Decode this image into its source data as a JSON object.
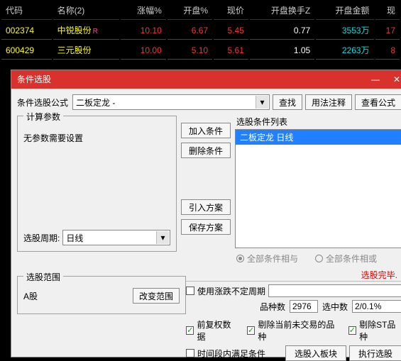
{
  "table": {
    "headers": [
      "代码",
      "名称(2)",
      "涨幅%",
      "开盘%",
      "现价",
      "开盘换手Z",
      "开盘金额",
      "现"
    ],
    "rows": [
      {
        "code": "002374",
        "name": "中锐股份",
        "flag": "R",
        "chg": "10.10",
        "openpct": "6.67",
        "price": "5.45",
        "turnover": "0.77",
        "amount": "3553万",
        "extra": "17"
      },
      {
        "code": "600429",
        "name": "三元股份",
        "flag": "",
        "chg": "10.00",
        "openpct": "5.10",
        "price": "5.61",
        "turnover": "1.05",
        "amount": "2263万",
        "extra": "8"
      }
    ]
  },
  "dialog": {
    "title": "条件选股",
    "formula_label": "条件选股公式",
    "formula_value": "二板定龙   -",
    "btn_search": "查找",
    "btn_usage": "用法注释",
    "btn_view": "查看公式",
    "calc_legend": "计算参数",
    "no_params": "无参数需要设置",
    "period_label": "选股周期:",
    "period_value": "日线",
    "btn_add": "加入条件",
    "btn_del": "删除条件",
    "btn_import": "引入方案",
    "btn_save": "保存方案",
    "list_label": "选股条件列表",
    "list_item": "二板定龙  日线",
    "radio_and": "全部条件相与",
    "radio_or": "全部条件相或",
    "range_legend": "选股范围",
    "range_value": "A股",
    "btn_change_range": "改变范围",
    "done_msg": "选股完毕.",
    "chk_use_period": "使用涨跌不定周期",
    "stats_kinds_label": "品种数",
    "stats_kinds_value": "2976",
    "stats_hits_label": "选中数",
    "stats_hits_value": "2/0.1%",
    "chk_fq": "前复权数据",
    "chk_remove_untraded": "剔除当前未交易的品种",
    "chk_remove_st": "剔除ST品种",
    "chk_time_range": "时间段内满足条件",
    "btn_to_block": "选股入板块",
    "btn_execute": "执行选股"
  }
}
